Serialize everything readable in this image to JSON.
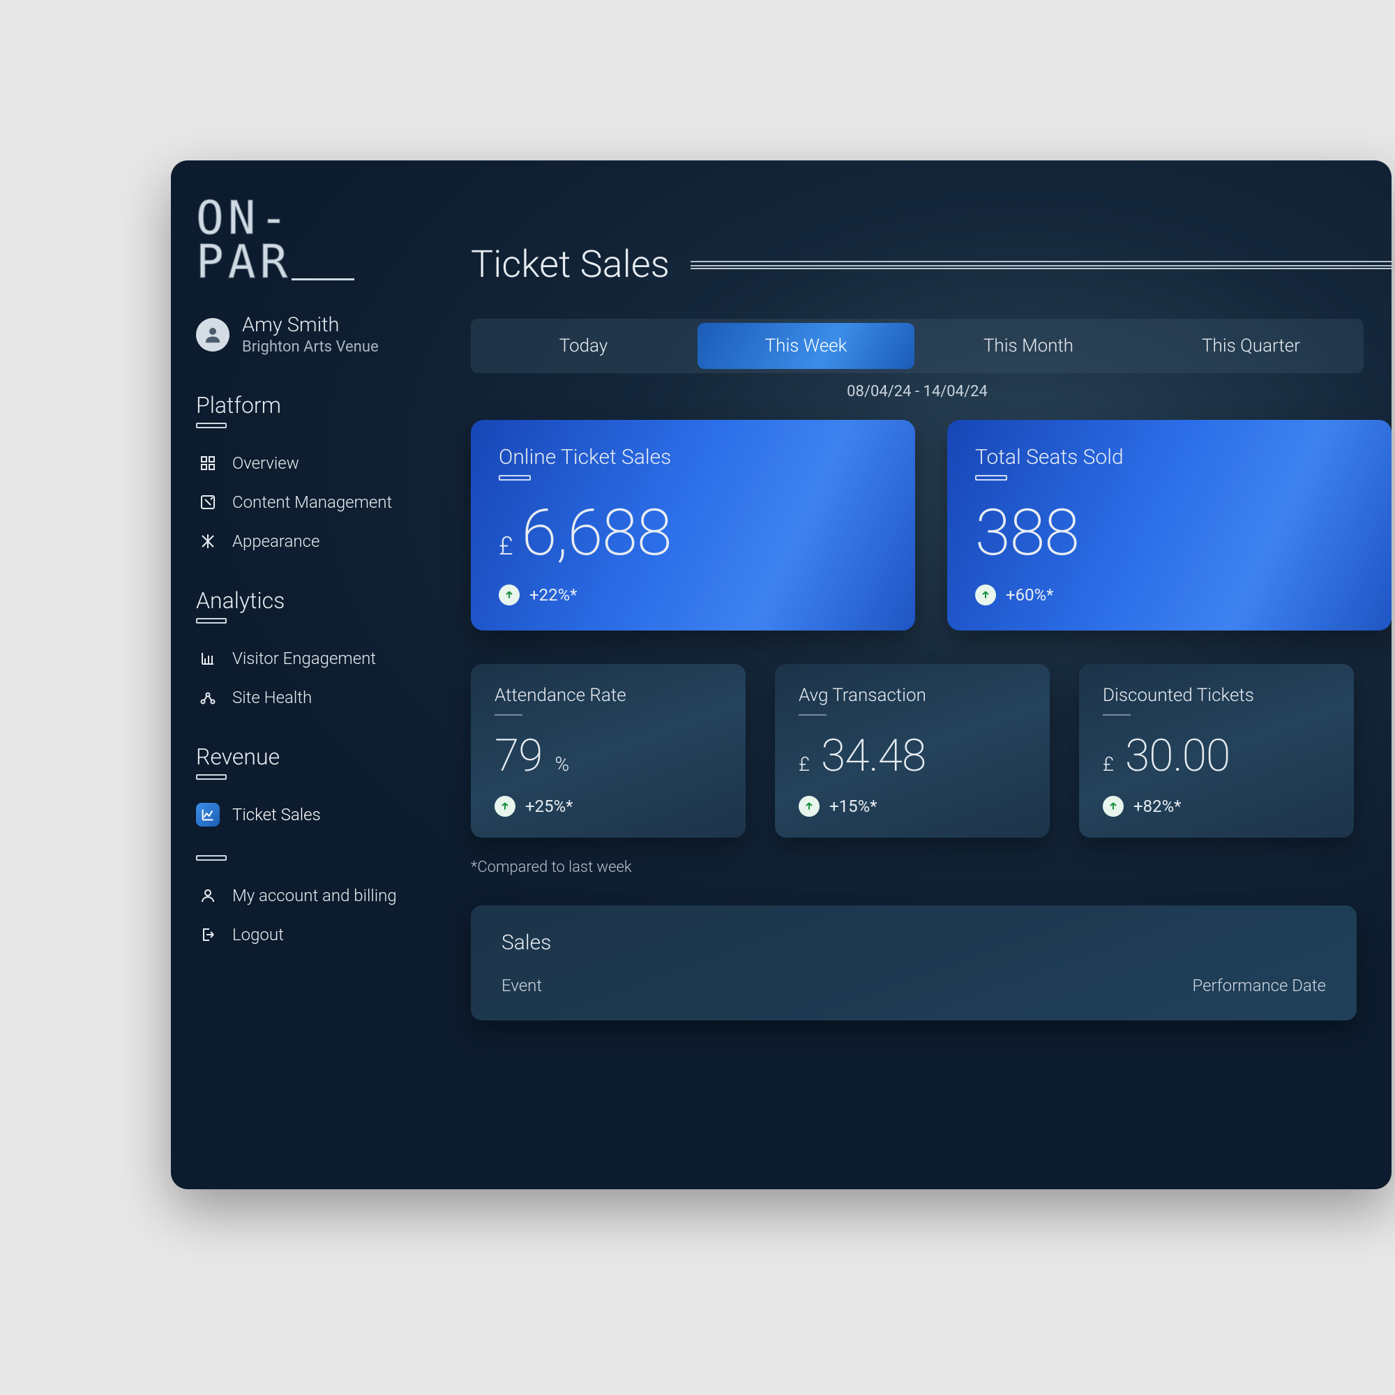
{
  "brand": {
    "line1": "ON-",
    "line2": "PAR"
  },
  "user": {
    "name": "Amy Smith",
    "venue": "Brighton Arts Venue"
  },
  "sidebar": {
    "sections": [
      {
        "title": "Platform",
        "items": [
          {
            "label": "Overview",
            "icon": "grid-icon"
          },
          {
            "label": "Content Management",
            "icon": "edit-box-icon"
          },
          {
            "label": "Appearance",
            "icon": "design-icon"
          }
        ]
      },
      {
        "title": "Analytics",
        "items": [
          {
            "label": "Visitor Engagement",
            "icon": "bar-chart-icon"
          },
          {
            "label": "Site Health",
            "icon": "nodes-icon"
          }
        ]
      },
      {
        "title": "Revenue",
        "items": [
          {
            "label": "Ticket Sales",
            "icon": "line-chart-icon",
            "active": true
          }
        ]
      }
    ],
    "account": [
      {
        "label": "My account and billing",
        "icon": "person-icon"
      },
      {
        "label": "Logout",
        "icon": "logout-icon"
      }
    ]
  },
  "page": {
    "title": "Ticket Sales",
    "tabs": [
      {
        "label": "Today"
      },
      {
        "label": "This Week",
        "active": true
      },
      {
        "label": "This Month"
      },
      {
        "label": "This Quarter"
      }
    ],
    "date_range": "08/04/24 - 14/04/24",
    "big_cards": [
      {
        "label": "Online Ticket Sales",
        "prefix": "£",
        "value": "6,688",
        "change": "+22%*"
      },
      {
        "label": "Total Seats Sold",
        "prefix": "",
        "value": "388",
        "change": "+60%*"
      }
    ],
    "small_cards": [
      {
        "label": "Attendance Rate",
        "prefix": "",
        "value": "79",
        "unit": "%",
        "change": "+25%*"
      },
      {
        "label": "Avg Transaction",
        "prefix": "£",
        "value": "34.48",
        "unit": "",
        "change": "+15%*"
      },
      {
        "label": "Discounted Tickets",
        "prefix": "£",
        "value": "30.00",
        "unit": "",
        "change": "+82%*"
      }
    ],
    "footnote": "*Compared to last week",
    "sales_table": {
      "title": "Sales",
      "cols": [
        "Event",
        "Performance Date"
      ]
    }
  }
}
